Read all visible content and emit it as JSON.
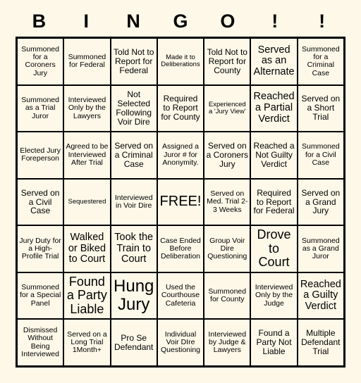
{
  "card": {
    "title": "BINGO Card",
    "header_letters": [
      "B",
      "I",
      "N",
      "G",
      "O",
      "!",
      "!"
    ],
    "free_space_label": "FREE!",
    "colors": {
      "background": "#fdf8e8",
      "cell_background": "#fdf8e8",
      "border": "#000000",
      "text": "#000000"
    },
    "grid": {
      "columns": 7,
      "rows": 7
    },
    "cells": [
      [
        {
          "text": "Summoned for a Coroners Jury",
          "size": "s"
        },
        {
          "text": "Summoned for Federal",
          "size": "s"
        },
        {
          "text": "Told Not to Report for Federal",
          "size": "m"
        },
        {
          "text": "Made it to Deliberations",
          "size": "xs"
        },
        {
          "text": "Told Not to Report for County",
          "size": "m"
        },
        {
          "text": "Served as an Alternate",
          "size": "l"
        },
        {
          "text": "Summoned for a Criminal Case",
          "size": "s"
        }
      ],
      [
        {
          "text": "Summoned as a Trial Juror",
          "size": "s"
        },
        {
          "text": "Interviewed Only by the Lawyers",
          "size": "s"
        },
        {
          "text": "Not Selected Following Voir Dire",
          "size": "m"
        },
        {
          "text": "Required to Report for County",
          "size": "m"
        },
        {
          "text": "Experienced a 'Jury View'",
          "size": "xs"
        },
        {
          "text": "Reached a Partial Verdict",
          "size": "l"
        },
        {
          "text": "Served on a Short Trial",
          "size": "m"
        }
      ],
      [
        {
          "text": "Elected Jury Foreperson",
          "size": "s"
        },
        {
          "text": "Agreed to be Interviewed After Trial",
          "size": "s"
        },
        {
          "text": "Served on a Criminal Case",
          "size": "m"
        },
        {
          "text": "Assigned a Juror # for Anonymity.",
          "size": "s"
        },
        {
          "text": "Served on a Coroners Jury",
          "size": "m"
        },
        {
          "text": "Reached a Not Guilty Verdict",
          "size": "m"
        },
        {
          "text": "Summoned for a Civil Case",
          "size": "s"
        }
      ],
      [
        {
          "text": "Served on a Civil Case",
          "size": "m"
        },
        {
          "text": "Sequestered",
          "size": "xs"
        },
        {
          "text": "Interviewed in Voir Dire",
          "size": "s"
        },
        {
          "text": "FREE!",
          "size": "free"
        },
        {
          "text": "Served on Med. Trial 2-3 Weeks",
          "size": "s"
        },
        {
          "text": "Required to Report for Federal",
          "size": "m"
        },
        {
          "text": "Served on a Grand Jury",
          "size": "m"
        }
      ],
      [
        {
          "text": "Jury Duty for a High-Profile Trial",
          "size": "s"
        },
        {
          "text": "Walked or Biked to Court",
          "size": "l"
        },
        {
          "text": "Took the Train to Court",
          "size": "l"
        },
        {
          "text": "Case Ended Before Deliberation",
          "size": "s"
        },
        {
          "text": "Group Voir Dire Questioning",
          "size": "s"
        },
        {
          "text": "Drove to Court",
          "size": "xl"
        },
        {
          "text": "Summoned as a Grand Juror",
          "size": "s"
        }
      ],
      [
        {
          "text": "Summoned for a Special Panel",
          "size": "s"
        },
        {
          "text": "Found a Party Liable",
          "size": "xl"
        },
        {
          "text": "Hung Jury",
          "size": "xxl"
        },
        {
          "text": "Used the Courthouse Cafeteria",
          "size": "s"
        },
        {
          "text": "Summoned for County",
          "size": "s"
        },
        {
          "text": "Interviewed Only by the Judge",
          "size": "s"
        },
        {
          "text": "Reached a Guilty Verdict",
          "size": "l"
        }
      ],
      [
        {
          "text": "Dismissed Without Being Interviewed",
          "size": "s"
        },
        {
          "text": "Served on a Long Trial 1Month+",
          "size": "s"
        },
        {
          "text": "Pro Se Defendant",
          "size": "m"
        },
        {
          "text": "Individual Voir DIre Questioning",
          "size": "s"
        },
        {
          "text": "Interviewed by Judge & Lawyers",
          "size": "s"
        },
        {
          "text": "Found a Party Not Liable",
          "size": "m"
        },
        {
          "text": "Multiple Defendant Trial",
          "size": "m"
        }
      ]
    ]
  }
}
